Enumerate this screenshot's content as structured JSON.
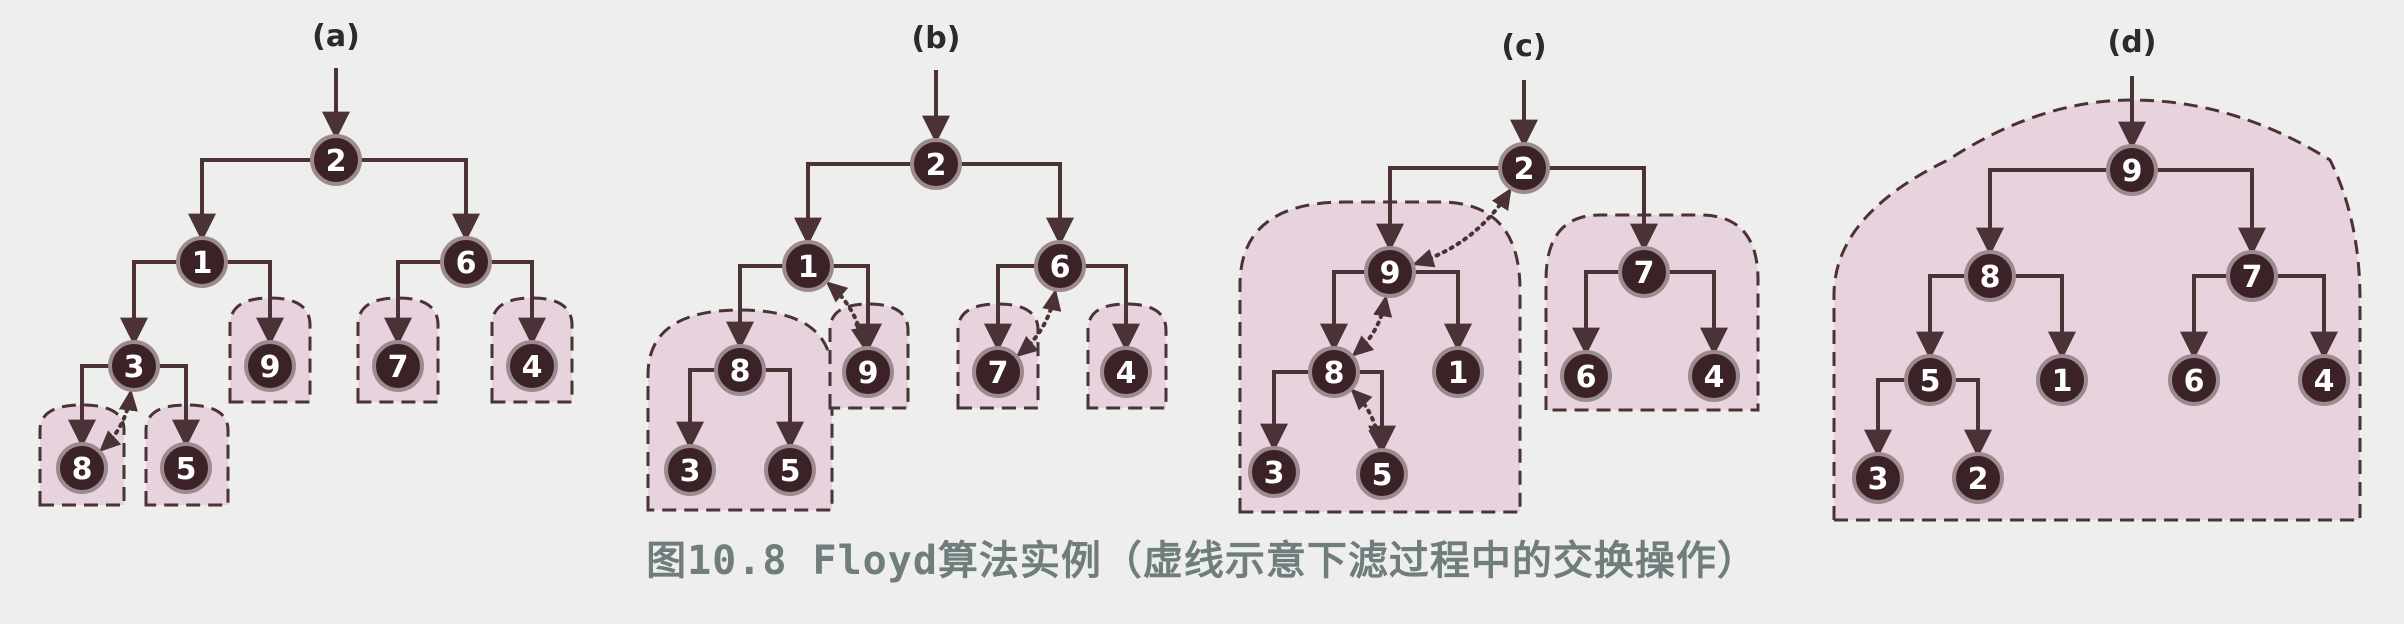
{
  "caption": "图10.8 Floyd算法实例（虚线示意下滤过程中的交换操作）",
  "colors": {
    "node_fill": "#3b2226",
    "node_ring": "#9c8a8f",
    "edge": "#4a3236",
    "region_fill": "#e6d3de",
    "region_stroke": "#4a3236",
    "background": "#eeeeed",
    "caption": "#6f7d7d"
  },
  "panels": [
    {
      "label": "(a)",
      "nodes": [
        {
          "id": "n2",
          "value": "2"
        },
        {
          "id": "n1",
          "value": "1"
        },
        {
          "id": "n6",
          "value": "6"
        },
        {
          "id": "n3",
          "value": "3"
        },
        {
          "id": "n9",
          "value": "9"
        },
        {
          "id": "n7",
          "value": "7"
        },
        {
          "id": "n4",
          "value": "4"
        },
        {
          "id": "n8",
          "value": "8"
        },
        {
          "id": "n5",
          "value": "5"
        }
      ],
      "edges": [
        [
          "n2",
          "n1"
        ],
        [
          "n2",
          "n6"
        ],
        [
          "n1",
          "n3"
        ],
        [
          "n1",
          "n9"
        ],
        [
          "n6",
          "n7"
        ],
        [
          "n6",
          "n4"
        ],
        [
          "n3",
          "n8"
        ],
        [
          "n3",
          "n5"
        ]
      ],
      "swaps": [
        [
          "n3",
          "n8"
        ]
      ]
    },
    {
      "label": "(b)",
      "nodes": [
        {
          "id": "n2",
          "value": "2"
        },
        {
          "id": "n1",
          "value": "1"
        },
        {
          "id": "n6",
          "value": "6"
        },
        {
          "id": "n8",
          "value": "8"
        },
        {
          "id": "n9",
          "value": "9"
        },
        {
          "id": "n7",
          "value": "7"
        },
        {
          "id": "n4",
          "value": "4"
        },
        {
          "id": "n3",
          "value": "3"
        },
        {
          "id": "n5",
          "value": "5"
        }
      ],
      "edges": [
        [
          "n2",
          "n1"
        ],
        [
          "n2",
          "n6"
        ],
        [
          "n1",
          "n8"
        ],
        [
          "n1",
          "n9"
        ],
        [
          "n6",
          "n7"
        ],
        [
          "n6",
          "n4"
        ],
        [
          "n8",
          "n3"
        ],
        [
          "n8",
          "n5"
        ]
      ],
      "swaps": [
        [
          "n1",
          "n9"
        ],
        [
          "n6",
          "n7"
        ]
      ]
    },
    {
      "label": "(c)",
      "nodes": [
        {
          "id": "n2",
          "value": "2"
        },
        {
          "id": "n9",
          "value": "9"
        },
        {
          "id": "n7",
          "value": "7"
        },
        {
          "id": "n8",
          "value": "8"
        },
        {
          "id": "n1",
          "value": "1"
        },
        {
          "id": "n6",
          "value": "6"
        },
        {
          "id": "n4",
          "value": "4"
        },
        {
          "id": "n3",
          "value": "3"
        },
        {
          "id": "n5",
          "value": "5"
        }
      ],
      "edges": [
        [
          "n2",
          "n9"
        ],
        [
          "n2",
          "n7"
        ],
        [
          "n9",
          "n8"
        ],
        [
          "n9",
          "n1"
        ],
        [
          "n7",
          "n6"
        ],
        [
          "n7",
          "n4"
        ],
        [
          "n8",
          "n3"
        ],
        [
          "n8",
          "n5"
        ]
      ],
      "swaps": [
        [
          "n2",
          "n9"
        ],
        [
          "n9",
          "n8"
        ],
        [
          "n8",
          "n5"
        ]
      ]
    },
    {
      "label": "(d)",
      "nodes": [
        {
          "id": "n9",
          "value": "9"
        },
        {
          "id": "n8",
          "value": "8"
        },
        {
          "id": "n7",
          "value": "7"
        },
        {
          "id": "n5",
          "value": "5"
        },
        {
          "id": "n1",
          "value": "1"
        },
        {
          "id": "n6",
          "value": "6"
        },
        {
          "id": "n4",
          "value": "4"
        },
        {
          "id": "n3",
          "value": "3"
        },
        {
          "id": "n2",
          "value": "2"
        }
      ],
      "edges": [
        [
          "n9",
          "n8"
        ],
        [
          "n9",
          "n7"
        ],
        [
          "n8",
          "n5"
        ],
        [
          "n8",
          "n1"
        ],
        [
          "n7",
          "n6"
        ],
        [
          "n7",
          "n4"
        ],
        [
          "n5",
          "n3"
        ],
        [
          "n5",
          "n2"
        ]
      ],
      "swaps": []
    }
  ]
}
